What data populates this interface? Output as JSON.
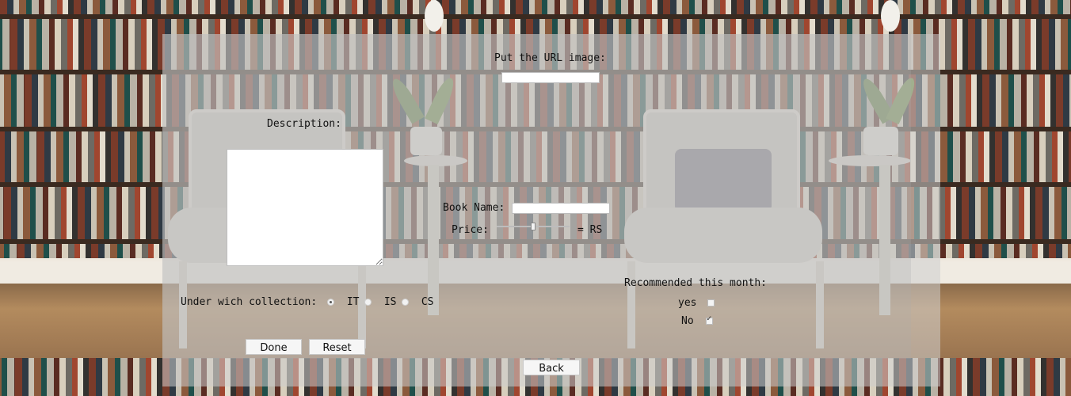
{
  "form": {
    "url_label": "Put the URL image:",
    "url_value": "",
    "description_label": "Description:",
    "description_value": "",
    "book_name_label": "Book Name:",
    "book_name_value": "",
    "price_label": "Price:",
    "price_value_fraction": 0.5,
    "price_suffix": "= RS",
    "collection_label": "Under wich collection:",
    "collections": [
      {
        "label": "IT",
        "checked": true
      },
      {
        "label": "IS",
        "checked": false
      },
      {
        "label": "CS",
        "checked": false
      }
    ],
    "recommended_label": "Recommended this month:",
    "recommended_options": [
      {
        "label": "yes",
        "checked": false
      },
      {
        "label": "No",
        "checked": true
      }
    ],
    "done_button": "Done",
    "reset_button": "Reset",
    "back_button": "Back"
  },
  "colors": {
    "overlay": "#cdcdcd",
    "button_bg": "#f6f6f6"
  }
}
